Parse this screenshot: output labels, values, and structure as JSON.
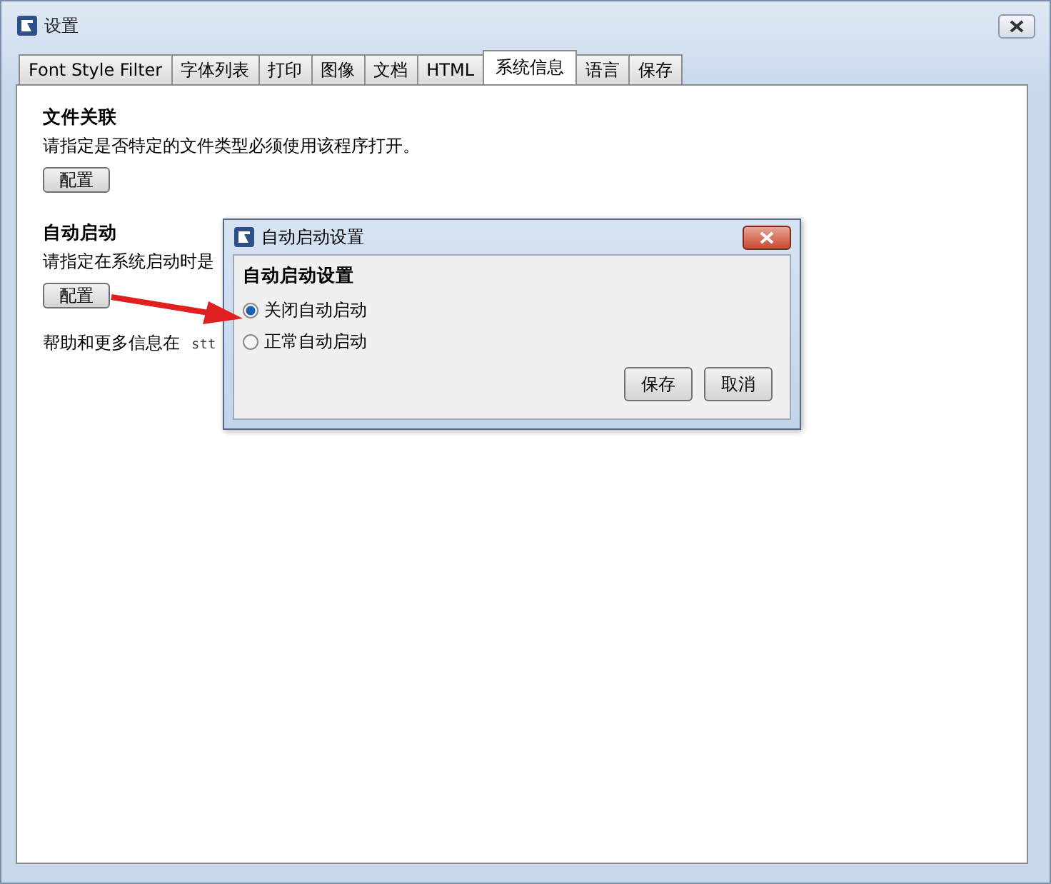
{
  "window": {
    "title": "设置"
  },
  "tabs": [
    {
      "label": "Font Style Filter",
      "selected": false
    },
    {
      "label": "字体列表",
      "selected": false
    },
    {
      "label": "打印",
      "selected": false
    },
    {
      "label": "图像",
      "selected": false
    },
    {
      "label": "文档",
      "selected": false
    },
    {
      "label": "HTML",
      "selected": false
    },
    {
      "label": "系统信息",
      "selected": true
    },
    {
      "label": "语言",
      "selected": false
    },
    {
      "label": "保存",
      "selected": false
    }
  ],
  "sections": [
    {
      "heading": "文件关联",
      "description": "请指定是否特定的文件类型必须使用该程序打开。",
      "button": "配置"
    },
    {
      "heading": "自动启动",
      "description": "请指定在系统启动时是",
      "button": "配置"
    }
  ],
  "help": {
    "text": "帮助和更多信息在",
    "link": "stt"
  },
  "dialog": {
    "title": "自动启动设置",
    "heading": "自动启动设置",
    "options": [
      {
        "label": "关闭自动启动",
        "selected": true
      },
      {
        "label": "正常自动启动",
        "selected": false
      }
    ],
    "buttons": [
      "保存",
      "取消"
    ]
  }
}
